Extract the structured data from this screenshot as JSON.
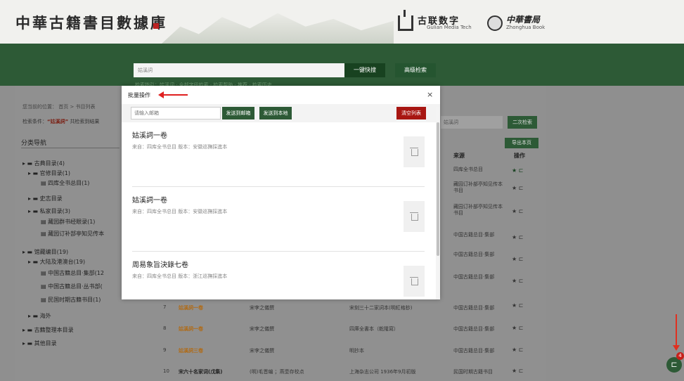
{
  "header": {
    "site_title": "中華古籍書目數據庫",
    "guilian_name": "古联数字",
    "guilian_sub": "Gulian Media Tech",
    "zhonghua_name": "中華書局",
    "zhonghua_sub": "Zhonghua Book"
  },
  "search": {
    "value": "姑溪詞",
    "quick_label": "一键快搜",
    "advanced_label": "高级检索",
    "hint": "检索指引：姑溪词 · 全部字段检索 · 检索帮助 · 推荐 · 检索历史"
  },
  "breadcrumb": "您当前的位置： 首页 > 书目列表",
  "conditions": {
    "prefix": "检索条件：",
    "term": "“姑溪詞”",
    "suffix": "共检索到结果"
  },
  "nav": {
    "title": "分类导航",
    "items": [
      "▸ ▬ 古典目录(4)",
      "▸ ▬ 官修目录(1)",
      "▤ 四库全书总目(1)",
      "▸ ▬ 史志目录",
      "▸ ▬ 私家目录(3)",
      "▤ 藏园群书经眼录(1)",
      "▤ 藏园订补部亭知见传本",
      "▸ ▬ 馆藏编目(19)",
      "▸ ▬ 大陆及港澳台(19)",
      "▤ 中国古籍总目·集部(12",
      "▤ 中国古籍总目·丛书部(",
      "▤ 民国时期古籍书目(1)",
      "▸ ▬ 海外",
      "▸ ▬ 古籍整理本目录",
      "▸ ▬ 其他目录"
    ]
  },
  "right_panel": {
    "search_value": "姑溪詞",
    "second_search": "二次检索",
    "export": "导出本页",
    "col_source": "来源",
    "col_action": "操作",
    "sources": [
      "四库全书总目",
      "藏园订补部亭知见传本书目",
      "藏园订补部亭知见传本书目",
      "中国古籍总目·集部",
      "中国古籍总目·集部",
      "中国古籍总目·集部"
    ],
    "rows": [
      {
        "num": "7",
        "title": "姑溪詞一卷",
        "author": "宋李之儀撰",
        "edition": "宋刻三十二家詞本(明紅格鈔)",
        "source": "中国古籍总目·集部"
      },
      {
        "num": "8",
        "title": "姑溪詞一卷",
        "author": "宋李之儀撰",
        "edition": "四庫全書本（乾隆寫）",
        "source": "中国古籍总目·集部"
      },
      {
        "num": "9",
        "title": "姑溪詞三卷",
        "author": "宋李之儀撰",
        "edition": "明抄本",
        "source": "中国古籍总目·集部"
      },
      {
        "num": "10",
        "title": "宋六十名家词(戊集)",
        "author": "(明)毛晋编 ；燕壶存校点",
        "edition": "上海杂志公司 1936年9月初版",
        "source": "民国时期古籍书目"
      }
    ]
  },
  "modal": {
    "title": "批量操作",
    "close": "×",
    "email_placeholder": "请输入邮箱",
    "send_email": "发送到邮箱",
    "send_local": "发送到本地",
    "clear": "清空列表",
    "entries": [
      {
        "title": "姑溪詞一卷",
        "meta": "来自：四库全书总目 版本：安徽巡撫採進本"
      },
      {
        "title": "姑溪詞一卷",
        "meta": "来自：四库全书总目 版本：安徽巡撫採進本"
      },
      {
        "title": "周易象旨決錄七卷",
        "meta": "来自：四库全书总目 版本：浙江巡撫採進本"
      }
    ]
  },
  "float": {
    "badge": "4",
    "icon": "cart-plus-icon"
  }
}
